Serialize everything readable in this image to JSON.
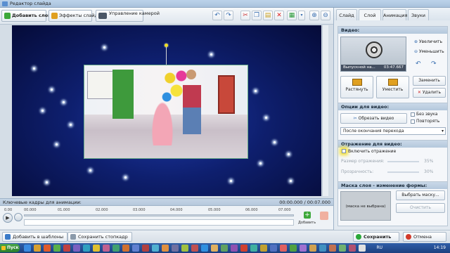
{
  "window": {
    "title": "Редактор слайда"
  },
  "toolbar": {
    "add_layer": "Добавить слой",
    "slide_effects": "Эффекты слайда",
    "camera_control": "Управление камерой"
  },
  "keyframes": {
    "title": "Ключевые кадры для анимации:",
    "current_time": "00:00.000",
    "total_time": "00:07.000",
    "time_sep": " / ",
    "ticks": [
      "0.00",
      "00.000",
      "01.000",
      "02.000",
      "03.000",
      "04.000",
      "05.000",
      "06.000",
      "07.000"
    ],
    "add_label": "Добавить"
  },
  "bottom": {
    "add_to_templates": "Добавить в шаблоны",
    "save_storyboard": "Сохранить стопкадр",
    "save": "Сохранить",
    "cancel": "Отмена"
  },
  "tabs": [
    "Слайд",
    "Слой",
    "Анимация",
    "Звуки"
  ],
  "video_section": {
    "title": "Видео:",
    "filename": "Выпускной на...",
    "duration": "03:47.667",
    "zoom_in": "Увеличить",
    "zoom_out": "Уменьшить",
    "stretch": "Растянуть",
    "fit": "Уместить",
    "replace": "Заменить",
    "delete": "Удалить"
  },
  "video_options": {
    "title": "Опции для видео:",
    "trim": "Обрезать видео",
    "no_sound": "Без звука",
    "repeat": "Повторять",
    "after_transition": "После окончания перехода"
  },
  "reflection": {
    "title": "Отражение для видео:",
    "enable": "Включить отражение",
    "size_label": "Размер отражения:",
    "size_value": "35%",
    "transparency_label": "Прозрачность:",
    "transparency_value": "30%"
  },
  "mask": {
    "title": "Маска слоя - изменение формы:",
    "no_mask": "(маска не выбрана)",
    "choose": "Выбрать маску...",
    "clear": "Очистить"
  },
  "taskbar": {
    "start": "Пуск",
    "lang": "RU",
    "clock": "14:19"
  }
}
